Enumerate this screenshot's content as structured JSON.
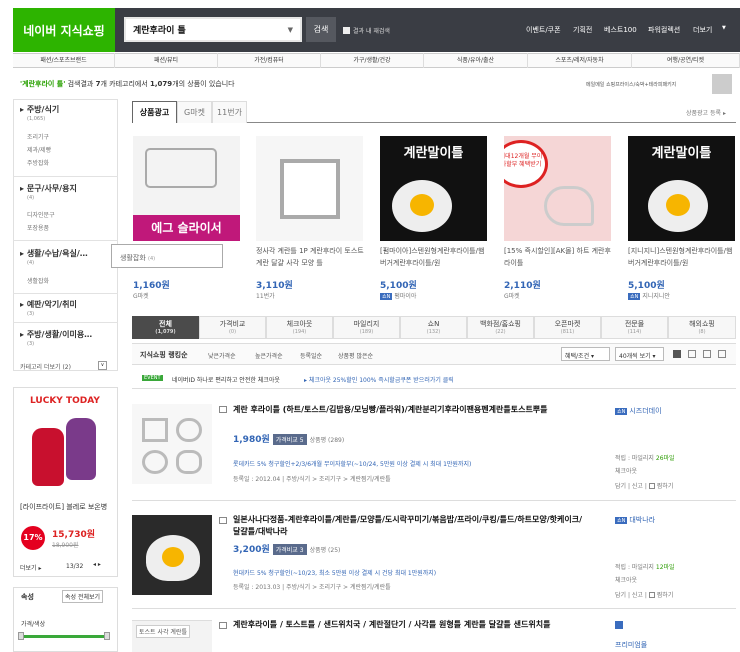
{
  "header": {
    "logo": "네이버 지식쇼핑",
    "search_value": "계란후라이 틀",
    "search_button": "검색",
    "within_results": "결과 내 재검색",
    "links": [
      "이벤트/쿠폰",
      "기획전",
      "베스트100",
      "파워컬렉션",
      "더보기"
    ]
  },
  "categories": [
    "패션/스포츠브랜드",
    "패션/뷰티",
    "가전/컴퓨터",
    "가구/생활/건강",
    "식품/유아/출산",
    "스포츠/레저/자동차",
    "여행/공연/티켓"
  ],
  "summary": {
    "keyword": "'계란후라이 틀'",
    "pre": "검색결과",
    "count_cat": "7",
    "mid": "개 카테고리에서",
    "count": "1,079",
    "post": "개의 상품이 있습니다",
    "ad": "메일메일 쇼핑프라이스/숙박+테라피패키지"
  },
  "sidebar": {
    "groups": [
      {
        "label": "주방/식기",
        "count": "(1,065)",
        "subs": [
          "조리기구",
          "제과/제빵",
          "주방잡화"
        ]
      },
      {
        "label": "문구/사무/용지",
        "count": "(4)",
        "subs": [
          "디자인문구",
          "포장용품"
        ]
      },
      {
        "label": "생활/수납/욕실/…",
        "count": "(4)",
        "subs": [
          "생활잡화"
        ]
      },
      {
        "label": "예판/악기/취미",
        "count": "(3)",
        "subs": []
      },
      {
        "label": "주방/생활/이미용…",
        "count": "(3)",
        "subs": []
      }
    ],
    "more": "카테고리 더보기 (2)",
    "popup": "생활잡화",
    "popup_count": "(4)"
  },
  "lucky": {
    "title": "LUCKY TODAY",
    "product": "[라이프라이트] 블레로 보온병",
    "discount": "17%",
    "price": "15,730원",
    "old": "18,900원",
    "more": "더보기",
    "page": "13/32"
  },
  "filter": {
    "sort": "속성",
    "all": "속성 전체보기",
    "price": "가격/색상"
  },
  "tabs": [
    "상품광고",
    "G마켓",
    "11번가"
  ],
  "ad_link": "상품광고 등록",
  "products": [
    {
      "title": "",
      "price": "1,160원",
      "mall": "G마켓",
      "img": "에그 슬라이서"
    },
    {
      "title": "정사각 계란틀 1P 계란후라이 토스트 계란 달걀 사각 모양 틀",
      "price": "3,110원",
      "mall": "11번가",
      "img": ""
    },
    {
      "title": "[펌마이아]스텐원형계란후라이틀/햄버거계란후라이틀/원",
      "price": "5,100원",
      "mall": "펌마이아",
      "img": "계란말이틀"
    },
    {
      "title": "[15% 즉시할인][AK몰] 하트 계란후라이틀",
      "price": "2,110원",
      "mall": "G마켓",
      "img": "최대12개월 무이자할부 혜택받기"
    },
    {
      "title": "[지니지니]스텐원형계란후라이틀/햄버거계란후라이틀/원",
      "price": "5,100원",
      "mall": "지니지니안",
      "img": "계란말이틀"
    }
  ],
  "compare_tabs": [
    {
      "label": "전체",
      "count": "(1,079)"
    },
    {
      "label": "가격비교",
      "count": "(0)"
    },
    {
      "label": "체크아웃",
      "count": "(194)"
    },
    {
      "label": "마일리지",
      "count": "(189)"
    },
    {
      "label": "쇼N",
      "count": "(132)"
    },
    {
      "label": "백화점/홈쇼핑",
      "count": "(22)"
    },
    {
      "label": "오픈마켓",
      "count": "(811)"
    },
    {
      "label": "전문몰",
      "count": "(114)"
    },
    {
      "label": "해외쇼핑",
      "count": "(8)"
    }
  ],
  "sort": {
    "label": "지식쇼핑 랭킹순",
    "options": [
      "낮은가격순",
      "높은가격순",
      "등록일순",
      "상품평 많은순"
    ],
    "benefit": "혜택/조건",
    "perpage": "40개씩 보기"
  },
  "event": {
    "tag": "EVENT",
    "text": "네이버ID 하나로 편리하고 안전한 체크아웃",
    "link": "체크아웃 25%할인 100% 즉시할금쿠폰 받으러가기 클릭"
  },
  "items": [
    {
      "title": "계란 후라이틀 (하트/토스트/김밥용/모닝빵/플라워)/계란분리기후라이팬용펜계란틀토스트뿌틀",
      "price": "1,980원",
      "compare": "가격비교 5",
      "review": "상품평 (289)",
      "promo": "롯데카드 5% 청구할인+2/3/6개월 무이자할부(~10/24, 5만원 이상 결제 시 최대 1만원까지)",
      "date": "등록일 : 2012.04",
      "cats": [
        "주방/식기",
        "조리기구",
        "계란찜기/계란틀"
      ],
      "seller": "시즈더데이",
      "seller_info": [
        "적립 : 마일리지",
        "26마일",
        "체크아웃"
      ],
      "actions": [
        "담기",
        "신고",
        "찜하기"
      ]
    },
    {
      "title": "일본사나다정품-계란후라이틀/계란틀/모양틀/도시락꾸미기/볶음밥/프라이/쿠킹/틀드/하트모양/핫케이크/달걀틀/대박나라",
      "price": "3,200원",
      "compare": "가격비교 3",
      "review": "상품평 (25)",
      "promo": "현대카드 5% 청구할인(~10/23, 최소 5만원 이상 결제 시 건당 최대 1만원까지)",
      "date": "등록일 : 2013.03",
      "cats": [
        "주방/식기",
        "조리기구",
        "계란찜기/계란틀"
      ],
      "seller": "대박나라",
      "seller_info": [
        "적립 : 마일리지",
        "12마일",
        "체크아웃"
      ],
      "actions": [
        "담기",
        "신고",
        "찜하기"
      ]
    },
    {
      "title": "계란후라이틀 / 토스트틀 / 샌드위치국 / 계란절단기 / 사각틀 원형틀 계란틀 달걀틀 샌드위치틀",
      "price": "",
      "compare": "",
      "review": "",
      "promo": "",
      "date": "",
      "cats": [],
      "seller": "프리미엄몰",
      "seller_info": [],
      "actions": [],
      "img": "토스트 사각 계란틀"
    }
  ]
}
